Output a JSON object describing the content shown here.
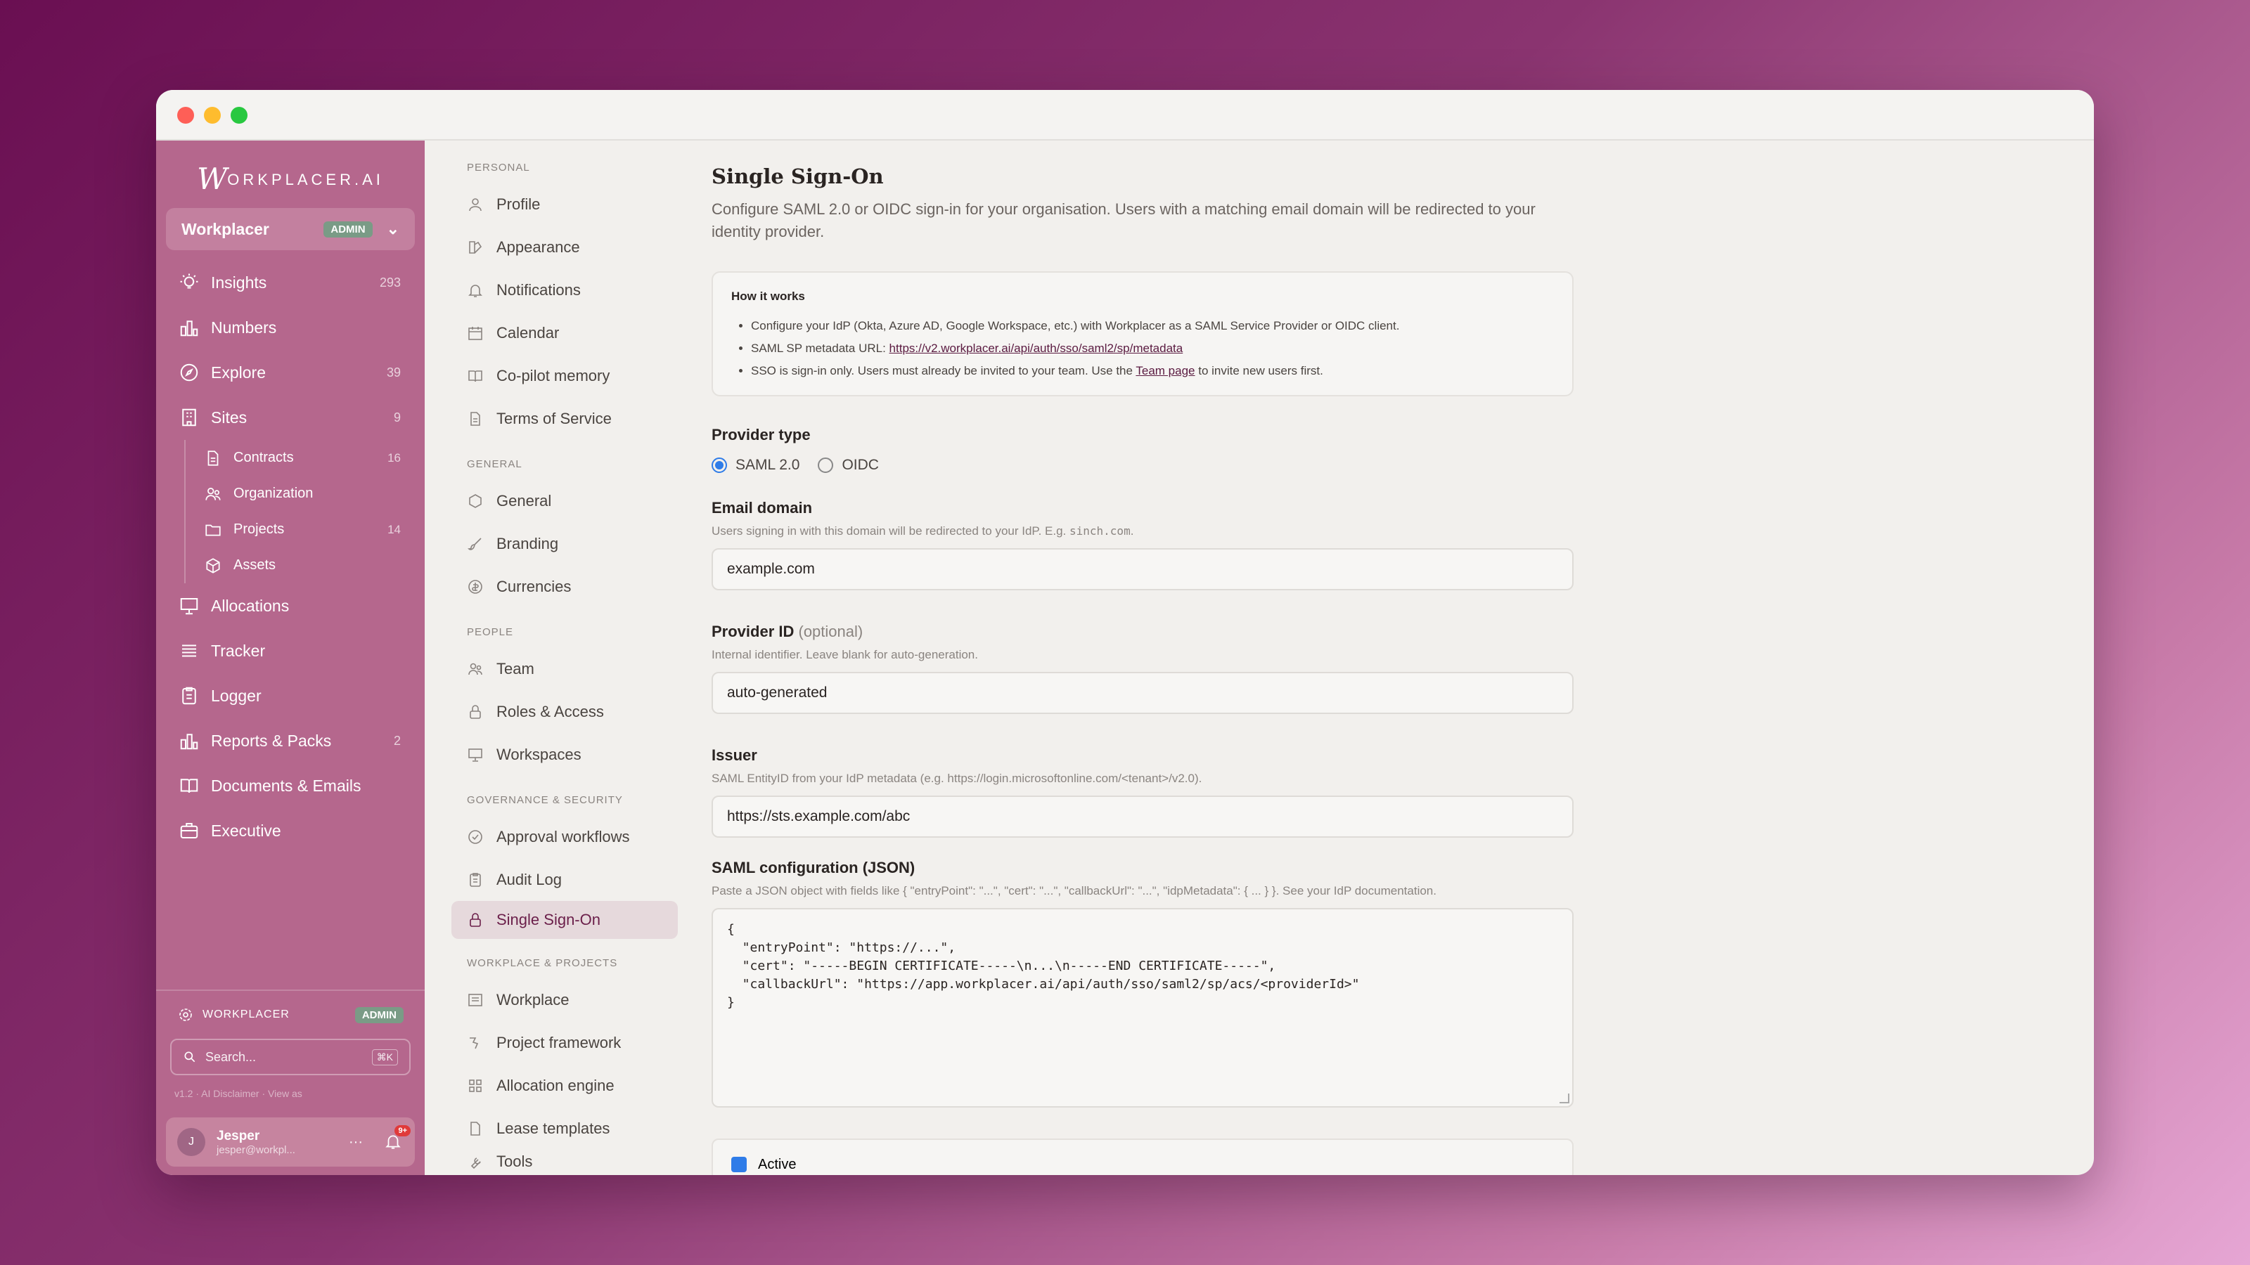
{
  "sidebar": {
    "logo_text": "ORKPLACER.AI",
    "org": {
      "name": "Workplacer",
      "badge": "ADMIN"
    },
    "items": [
      {
        "label": "Insights",
        "count": "293"
      },
      {
        "label": "Numbers",
        "count": ""
      },
      {
        "label": "Explore",
        "count": "39"
      },
      {
        "label": "Sites",
        "count": "9"
      }
    ],
    "sub_items": [
      {
        "label": "Contracts",
        "count": "16"
      },
      {
        "label": "Organization",
        "count": ""
      },
      {
        "label": "Projects",
        "count": "14"
      },
      {
        "label": "Assets",
        "count": ""
      }
    ],
    "items2": [
      {
        "label": "Allocations",
        "count": ""
      },
      {
        "label": "Tracker",
        "count": ""
      },
      {
        "label": "Logger",
        "count": ""
      },
      {
        "label": "Reports & Packs",
        "count": "2"
      },
      {
        "label": "Documents & Emails",
        "count": ""
      },
      {
        "label": "Executive",
        "count": ""
      }
    ],
    "workspace": {
      "label": "WORKPLACER",
      "badge": "ADMIN"
    },
    "search": {
      "placeholder": "Search...",
      "shortcut": "⌘K"
    },
    "meta": "v1.2 · AI Disclaimer · View as",
    "user": {
      "initial": "J",
      "name": "Jesper",
      "email": "jesper@workpl...",
      "notif_count": "9+"
    }
  },
  "settings_nav": {
    "personal": {
      "title": "PERSONAL",
      "items": [
        "Profile",
        "Appearance",
        "Notifications",
        "Calendar",
        "Co-pilot memory",
        "Terms of Service"
      ]
    },
    "general": {
      "title": "GENERAL",
      "items": [
        "General",
        "Branding",
        "Currencies"
      ]
    },
    "people": {
      "title": "PEOPLE",
      "items": [
        "Team",
        "Roles & Access",
        "Workspaces"
      ]
    },
    "governance": {
      "title": "GOVERNANCE & SECURITY",
      "items": [
        "Approval workflows",
        "Audit Log",
        "Single Sign-On"
      ]
    },
    "workplace": {
      "title": "WORKPLACE & PROJECTS",
      "items": [
        "Workplace",
        "Project framework",
        "Allocation engine",
        "Lease templates",
        "Tools"
      ]
    }
  },
  "main": {
    "title": "Single Sign-On",
    "description": "Configure SAML 2.0 or OIDC sign-in for your organisation. Users with a matching email domain will be redirected to your identity provider.",
    "how_it_works": {
      "title": "How it works",
      "bullet1": "Configure your IdP (Okta, Azure AD, Google Workspace, etc.) with Workplacer as a SAML Service Provider or OIDC client.",
      "bullet2_prefix": "SAML SP metadata URL: ",
      "bullet2_link": "https://v2.workplacer.ai/api/auth/sso/saml2/sp/metadata",
      "bullet3_prefix": "SSO is sign-in only. Users must already be invited to your team. Use the ",
      "bullet3_link": "Team page",
      "bullet3_suffix": " to invite new users first."
    },
    "provider_type": {
      "label": "Provider type",
      "options": [
        "SAML 2.0",
        "OIDC"
      ],
      "selected": "SAML 2.0"
    },
    "email_domain": {
      "label": "Email domain",
      "hint_prefix": "Users signing in with this domain will be redirected to your IdP. E.g. ",
      "hint_code": "sinch.com",
      "hint_suffix": ".",
      "value": "example.com"
    },
    "provider_id": {
      "label": "Provider ID",
      "optional": "(optional)",
      "hint": "Internal identifier. Leave blank for auto-generation.",
      "value": "auto-generated"
    },
    "issuer": {
      "label": "Issuer",
      "hint": "SAML EntityID from your IdP metadata (e.g. https://login.microsoftonline.com/<tenant>/v2.0).",
      "value": "https://sts.example.com/abc"
    },
    "saml_config": {
      "label": "SAML configuration (JSON)",
      "hint": "Paste a JSON object with fields like { \"entryPoint\": \"...\", \"cert\": \"...\", \"callbackUrl\": \"...\", \"idpMetadata\": { ... } }. See your IdP documentation.",
      "value": "{\n  \"entryPoint\": \"https://...\",\n  \"cert\": \"-----BEGIN CERTIFICATE-----\\n...\\n-----END CERTIFICATE-----\",\n  \"callbackUrl\": \"https://app.workplacer.ai/api/auth/sso/saml2/sp/acs/<providerId>\"\n}"
    },
    "active_label": "Active"
  }
}
